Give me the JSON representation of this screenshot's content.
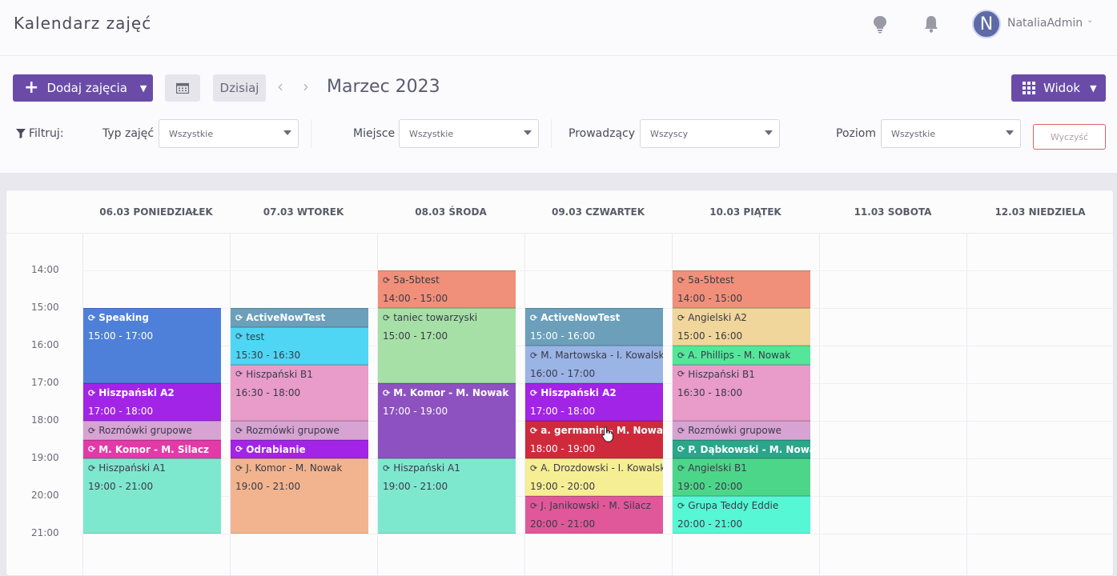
{
  "app": {
    "title": "Kalendarz zajęć",
    "user_name": "NataliaAdmin",
    "avatar_letter": "N"
  },
  "toolbar": {
    "add_label": "Dodaj zajęcia",
    "today_label": "Dzisiaj",
    "month_title": "Marzec 2023",
    "view_label": "Widok"
  },
  "filters": {
    "label": "Filtruj:",
    "type_label": "Typ zajęć",
    "type_value": "Wszystkie",
    "place_label": "Miejsce",
    "place_value": "Wszystkie",
    "teacher_label": "Prowadzący",
    "teacher_value": "Wszyscy",
    "level_label": "Poziom",
    "level_value": "Wszystkie",
    "clear_label": "Wyczyść"
  },
  "days": [
    "06.03 PONIEDZIAŁEK",
    "07.03 WTOREK",
    "08.03 ŚRODA",
    "09.03 CZWARTEK",
    "10.03 PIĄTEK",
    "11.03 SOBOTA",
    "12.03 NIEDZIELA"
  ],
  "hours": [
    "14:00",
    "15:00",
    "16:00",
    "17:00",
    "18:00",
    "19:00",
    "20:00",
    "21:00"
  ],
  "events": [
    {
      "day": 0,
      "start": "15:00",
      "end": "17:00",
      "title": "Speaking",
      "time": "15:00 - 17:00",
      "color": "#4f80d9",
      "light": true
    },
    {
      "day": 0,
      "start": "17:00",
      "end": "18:00",
      "title": "Hiszpański A2",
      "time": "17:00 - 18:00",
      "color": "#a224e6",
      "light": true
    },
    {
      "day": 0,
      "start": "18:00",
      "end": "18:30",
      "title": "Rozmówki grupowe",
      "time": "",
      "color": "#d6a3d2",
      "light": false
    },
    {
      "day": 0,
      "start": "18:30",
      "end": "19:00",
      "title": "M. Komor - M. Silacz",
      "time": "",
      "color": "#e33aa8",
      "light": true
    },
    {
      "day": 0,
      "start": "19:00",
      "end": "21:00",
      "title": "Hiszpański A1",
      "time": "19:00 - 21:00",
      "color": "#7ee8cf",
      "light": false
    },
    {
      "day": 1,
      "start": "15:00",
      "end": "15:30",
      "title": "ActiveNowTest",
      "time": "",
      "color": "#6b9fba",
      "light": true
    },
    {
      "day": 1,
      "start": "15:30",
      "end": "16:30",
      "title": "test",
      "time": "15:30 - 16:30",
      "color": "#4fd6f4",
      "light": false
    },
    {
      "day": 1,
      "start": "16:30",
      "end": "18:00",
      "title": "Hiszpański B1",
      "time": "16:30 - 18:00",
      "color": "#e99bc9",
      "light": false
    },
    {
      "day": 1,
      "start": "18:00",
      "end": "18:30",
      "title": "Rozmówki grupowe",
      "time": "",
      "color": "#d6a3d2",
      "light": false
    },
    {
      "day": 1,
      "start": "18:30",
      "end": "19:00",
      "title": "Odrabianie",
      "time": "",
      "color": "#a224e6",
      "light": true
    },
    {
      "day": 1,
      "start": "19:00",
      "end": "21:00",
      "title": "J. Komor - M. Nowak",
      "time": "19:00 - 21:00",
      "color": "#f2b48e",
      "light": false
    },
    {
      "day": 2,
      "start": "14:00",
      "end": "15:00",
      "title": "5a-5btest",
      "time": "14:00 - 15:00",
      "color": "#f0907a",
      "light": false
    },
    {
      "day": 2,
      "start": "15:00",
      "end": "17:00",
      "title": "taniec towarzyski",
      "time": "15:00 - 17:00",
      "color": "#a6e0a6",
      "light": false
    },
    {
      "day": 2,
      "start": "17:00",
      "end": "19:00",
      "title": "M. Komor - M. Nowak",
      "time": "17:00 - 19:00",
      "color": "#8e52c0",
      "light": true
    },
    {
      "day": 2,
      "start": "19:00",
      "end": "21:00",
      "title": "Hiszpański A1",
      "time": "19:00 - 21:00",
      "color": "#7ee8cf",
      "light": false
    },
    {
      "day": 3,
      "start": "15:00",
      "end": "16:00",
      "title": "ActiveNowTest",
      "time": "15:00 - 16:00",
      "color": "#6b9fba",
      "light": true
    },
    {
      "day": 3,
      "start": "16:00",
      "end": "17:00",
      "title": "M. Martowska - I. Kowalska",
      "time": "16:00 - 17:00",
      "color": "#9ab4e6",
      "light": false
    },
    {
      "day": 3,
      "start": "17:00",
      "end": "18:00",
      "title": "Hiszpański A2",
      "time": "17:00 - 18:00",
      "color": "#a224e6",
      "light": true
    },
    {
      "day": 3,
      "start": "18:00",
      "end": "19:00",
      "title": "a. germanin - M. Nowak",
      "time": "18:00 - 19:00",
      "color": "#cf2a3c",
      "light": true
    },
    {
      "day": 3,
      "start": "19:00",
      "end": "20:00",
      "title": "A. Drozdowski - I. Kowalska",
      "time": "19:00 - 20:00",
      "color": "#f6ee92",
      "light": false
    },
    {
      "day": 3,
      "start": "20:00",
      "end": "21:00",
      "title": "J. Janikowski - M. Silacz",
      "time": "20:00 - 21:00",
      "color": "#e0589a",
      "light": false
    },
    {
      "day": 4,
      "start": "14:00",
      "end": "15:00",
      "title": "5a-5btest",
      "time": "14:00 - 15:00",
      "color": "#f0907a",
      "light": false
    },
    {
      "day": 4,
      "start": "15:00",
      "end": "16:00",
      "title": "Angielski A2",
      "time": "15:00 - 16:00",
      "color": "#f0d69a",
      "light": false
    },
    {
      "day": 4,
      "start": "16:00",
      "end": "16:30",
      "title": "A. Phillips - M. Nowak",
      "time": "",
      "color": "#54e79a",
      "light": false
    },
    {
      "day": 4,
      "start": "16:30",
      "end": "18:00",
      "title": "Hiszpański B1",
      "time": "16:30 - 18:00",
      "color": "#e99bc9",
      "light": false
    },
    {
      "day": 4,
      "start": "18:00",
      "end": "18:30",
      "title": "Rozmówki grupowe",
      "time": "",
      "color": "#d6a3d2",
      "light": false
    },
    {
      "day": 4,
      "start": "18:30",
      "end": "19:00",
      "title": "P. Dąbkowski - M. Nowak",
      "time": "",
      "color": "#2aa68a",
      "light": true
    },
    {
      "day": 4,
      "start": "19:00",
      "end": "20:00",
      "title": "Angielski B1",
      "time": "19:00 - 20:00",
      "color": "#4cd68a",
      "light": false
    },
    {
      "day": 4,
      "start": "20:00",
      "end": "21:00",
      "title": "Grupa Teddy Eddie",
      "time": "20:00 - 21:00",
      "color": "#56f7d4",
      "light": false
    }
  ]
}
